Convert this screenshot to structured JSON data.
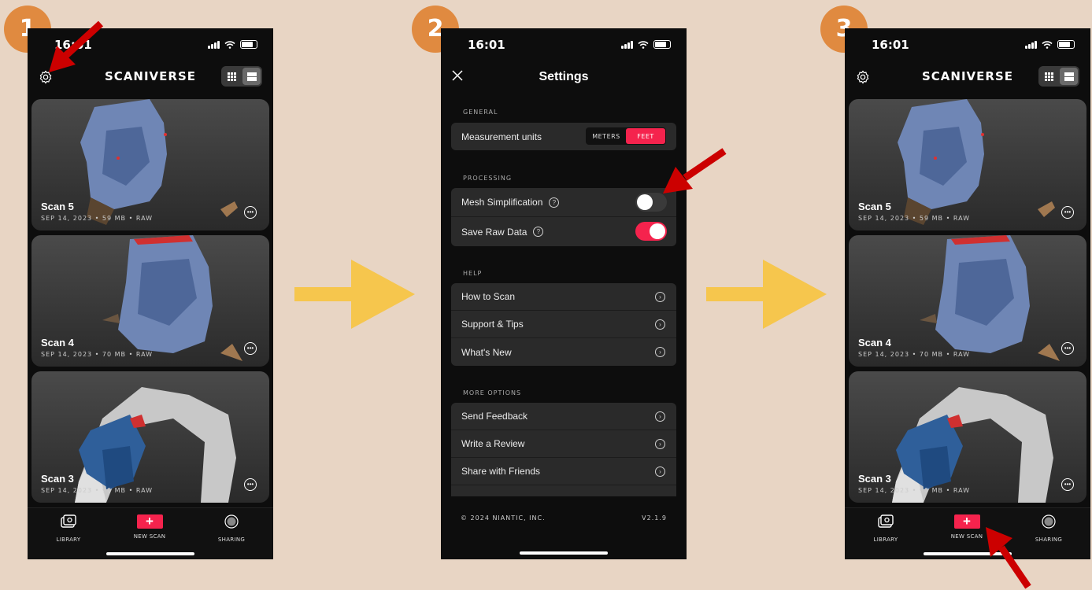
{
  "steps": [
    "1",
    "2",
    "3"
  ],
  "status_time": "16:01",
  "library": {
    "title": "SCANIVERSE",
    "scans": [
      {
        "name": "Scan 5",
        "meta": "SEP 14, 2023  •  59 MB  •  RAW"
      },
      {
        "name": "Scan 4",
        "meta": "SEP 14, 2023  •  70 MB  •  RAW"
      },
      {
        "name": "Scan 3",
        "meta": "SEP 14, 2023  •  90 MB  •  RAW"
      }
    ],
    "tabs": {
      "library": "LIBRARY",
      "new_scan": "NEW SCAN",
      "sharing": "SHARING"
    },
    "new_scan_symbol": "+",
    "more_symbol": "•••"
  },
  "settings": {
    "title": "Settings",
    "general_label": "GENERAL",
    "measurement_units": "Measurement units",
    "unit_meters": "METERS",
    "unit_feet": "FEET",
    "selected_unit": "FEET",
    "processing_label": "PROCESSING",
    "mesh_simplification": "Mesh Simplification",
    "mesh_simplification_on": false,
    "save_raw_data": "Save Raw Data",
    "save_raw_data_on": true,
    "help_label": "HELP",
    "help_items": [
      "How to Scan",
      "Support & Tips",
      "What's New"
    ],
    "more_options_label": "MORE OPTIONS",
    "more_items": [
      "Send Feedback",
      "Write a Review",
      "Share with Friends"
    ],
    "copyright": "© 2024 NIANTIC, INC.",
    "version": "V2.1.9",
    "question_symbol": "?",
    "chevron_symbol": "›"
  },
  "colors": {
    "accent": "#f5234d",
    "background": "#e8d5c4",
    "badge": "#e08a40",
    "arrow": "#f6c64d",
    "pointer": "#cc0000"
  },
  "icons": [
    "gear-icon",
    "grid-view-icon",
    "list-view-icon",
    "close-icon",
    "library-icon",
    "plus-icon",
    "sharing-icon",
    "chevron-right-icon",
    "help-circle-icon",
    "more-icon"
  ]
}
